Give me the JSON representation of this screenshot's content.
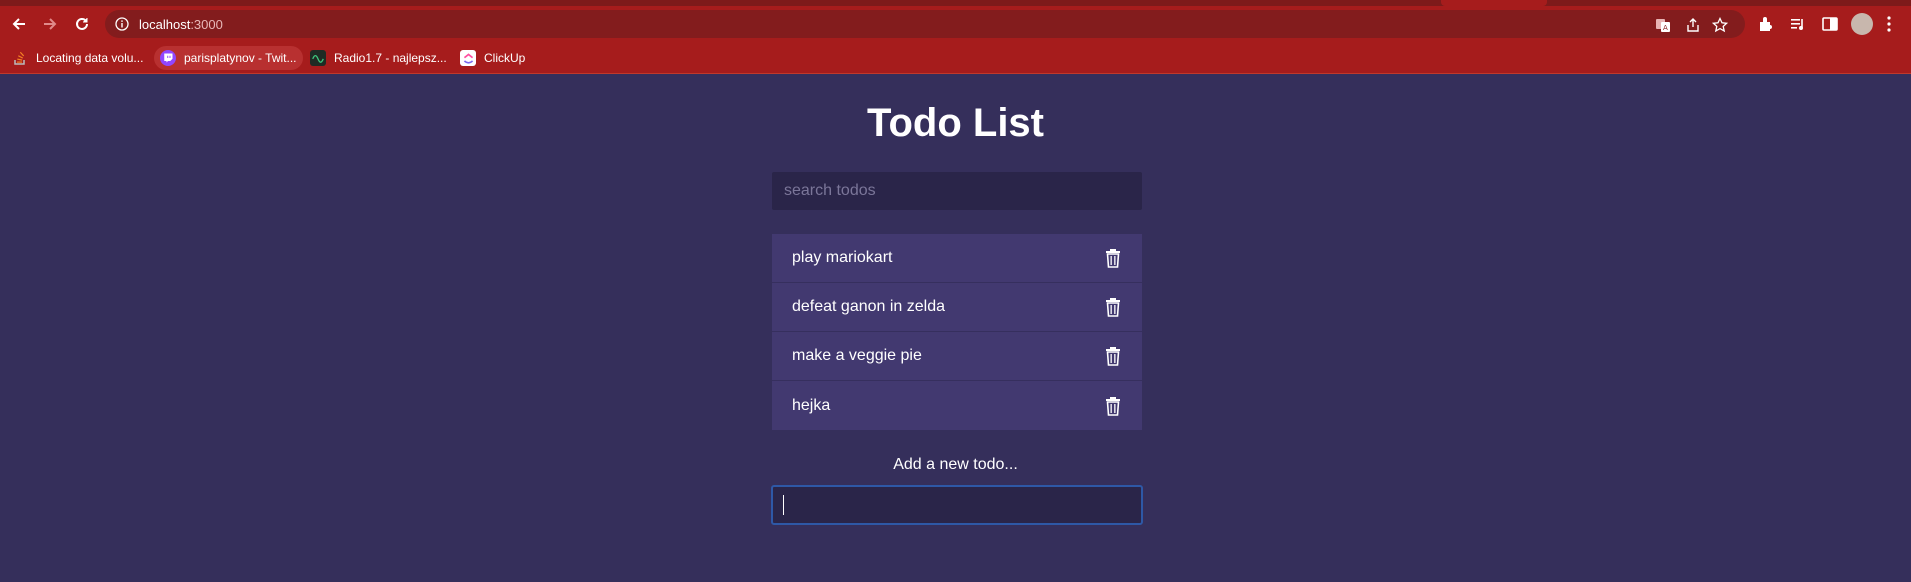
{
  "browser": {
    "url_host": "localhost",
    "url_port": ":3000",
    "bookmarks": [
      {
        "label": "Locating data volu...",
        "icon": "stack-overflow-icon",
        "color": "#f48024"
      },
      {
        "label": "parisplatynov - Twit...",
        "icon": "twitch-icon",
        "color": "#9146ff"
      },
      {
        "label": "Radio1.7 - najlepsz...",
        "icon": "radio-wave-icon",
        "color": "#1f2b24"
      },
      {
        "label": "ClickUp",
        "icon": "clickup-icon",
        "color": "#ffffff"
      }
    ]
  },
  "app": {
    "title": "Todo List",
    "search_placeholder": "search todos",
    "todos": [
      {
        "text": "play mariokart"
      },
      {
        "text": "defeat ganon in zelda"
      },
      {
        "text": "make a veggie pie"
      },
      {
        "text": "hejka"
      }
    ],
    "add_label": "Add a new todo...",
    "add_value": ""
  },
  "colors": {
    "page_bg": "#352f5b",
    "chrome_bg": "#a61c1c",
    "item_bg": "#423970",
    "input_bg": "#2a2549",
    "focus_border": "#2e58a6"
  }
}
